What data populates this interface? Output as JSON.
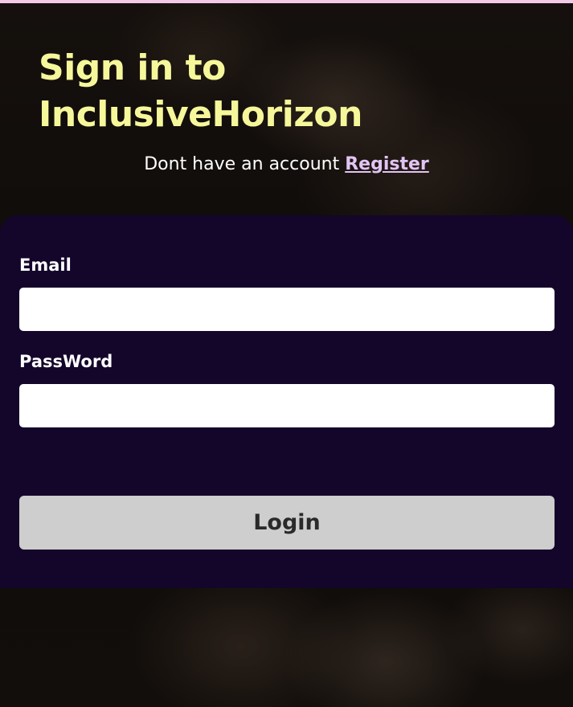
{
  "header": {
    "title": "Sign in to InclusiveHorizon",
    "register_prompt": "Dont have an account ",
    "register_link": "Register"
  },
  "form": {
    "email": {
      "label": "Email",
      "value": "",
      "placeholder": ""
    },
    "password": {
      "label": "PassWord",
      "value": "",
      "placeholder": ""
    },
    "login_label": "Login"
  },
  "colors": {
    "title": "#f6f79a",
    "link": "#e2c4f4",
    "card_background": "#14052a",
    "button_background": "#cecece",
    "top_stripe": "#f3c9e8"
  }
}
